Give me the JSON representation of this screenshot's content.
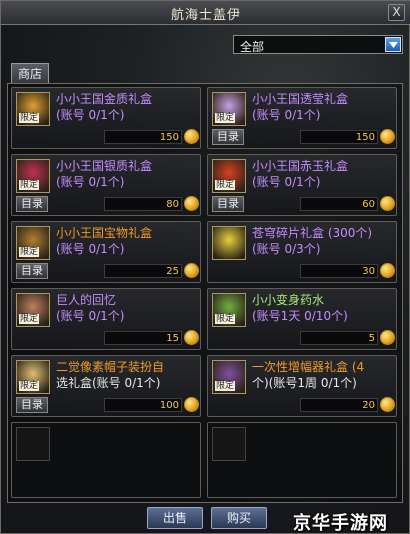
{
  "window": {
    "title": "航海士盖伊",
    "close_label": "X"
  },
  "filter": {
    "value": "全部"
  },
  "tab": {
    "label": "商店"
  },
  "items": [
    {
      "name": "小小王国金质礼盒",
      "sub": "(账号 0/1个)",
      "price": "150",
      "tag": "限定",
      "menu": "",
      "name_color": "purple",
      "sub_color": "purple",
      "icon_color": "#e0a030"
    },
    {
      "name": "小小王国透莹礼盒",
      "sub": "(账号 0/1个)",
      "price": "150",
      "tag": "限定",
      "menu": "目录",
      "name_color": "purple",
      "sub_color": "purple",
      "icon_color": "#c8a0e0"
    },
    {
      "name": "小小王国银质礼盒",
      "sub": "(账号 0/1个)",
      "price": "80",
      "tag": "限定",
      "menu": "目录",
      "name_color": "purple",
      "sub_color": "purple",
      "icon_color": "#c03050"
    },
    {
      "name": "小小王国赤玉礼盒",
      "sub": "(账号 0/1个)",
      "price": "60",
      "tag": "限定",
      "menu": "目录",
      "name_color": "purple",
      "sub_color": "purple",
      "icon_color": "#d84020"
    },
    {
      "name": "小小王国宝物礼盒",
      "sub": "(账号 0/1个)",
      "price": "25",
      "tag": "限定",
      "menu": "目录",
      "name_color": "orange",
      "sub_color": "purple",
      "icon_color": "#b08030"
    },
    {
      "name": "苍穹碎片礼盒 (300个)",
      "sub": "(账号 0/3个)",
      "price": "30",
      "tag": "",
      "menu": "",
      "name_color": "purple",
      "sub_color": "purple",
      "icon_color": "#e8d040"
    },
    {
      "name": "巨人的回忆",
      "sub": "(账号 0/1个)",
      "price": "15",
      "tag": "限定",
      "menu": "",
      "name_color": "purple",
      "sub_color": "purple",
      "icon_color": "#c08060"
    },
    {
      "name": "小小变身药水",
      "sub": "(账号1天 0/10个)",
      "price": "5",
      "tag": "限定",
      "menu": "",
      "name_color": "green",
      "sub_color": "purple",
      "icon_color": "#70b040"
    },
    {
      "name": "二觉像素帽子装扮自",
      "sub": "选礼盒(账号 0/1个)",
      "price": "100",
      "tag": "限定",
      "menu": "目录",
      "name_color": "orange",
      "sub_color": "white",
      "icon_color": "#e0c070"
    },
    {
      "name": "一次性增幅器礼盒 (4",
      "sub": "个)(账号1周 0/1个)",
      "price": "20",
      "tag": "限定",
      "menu": "",
      "name_color": "orange",
      "sub_color": "white",
      "icon_color": "#8050a0"
    }
  ],
  "footer": {
    "sell_label": "出售",
    "buy_label": "购买"
  },
  "watermark": "京华手游网"
}
